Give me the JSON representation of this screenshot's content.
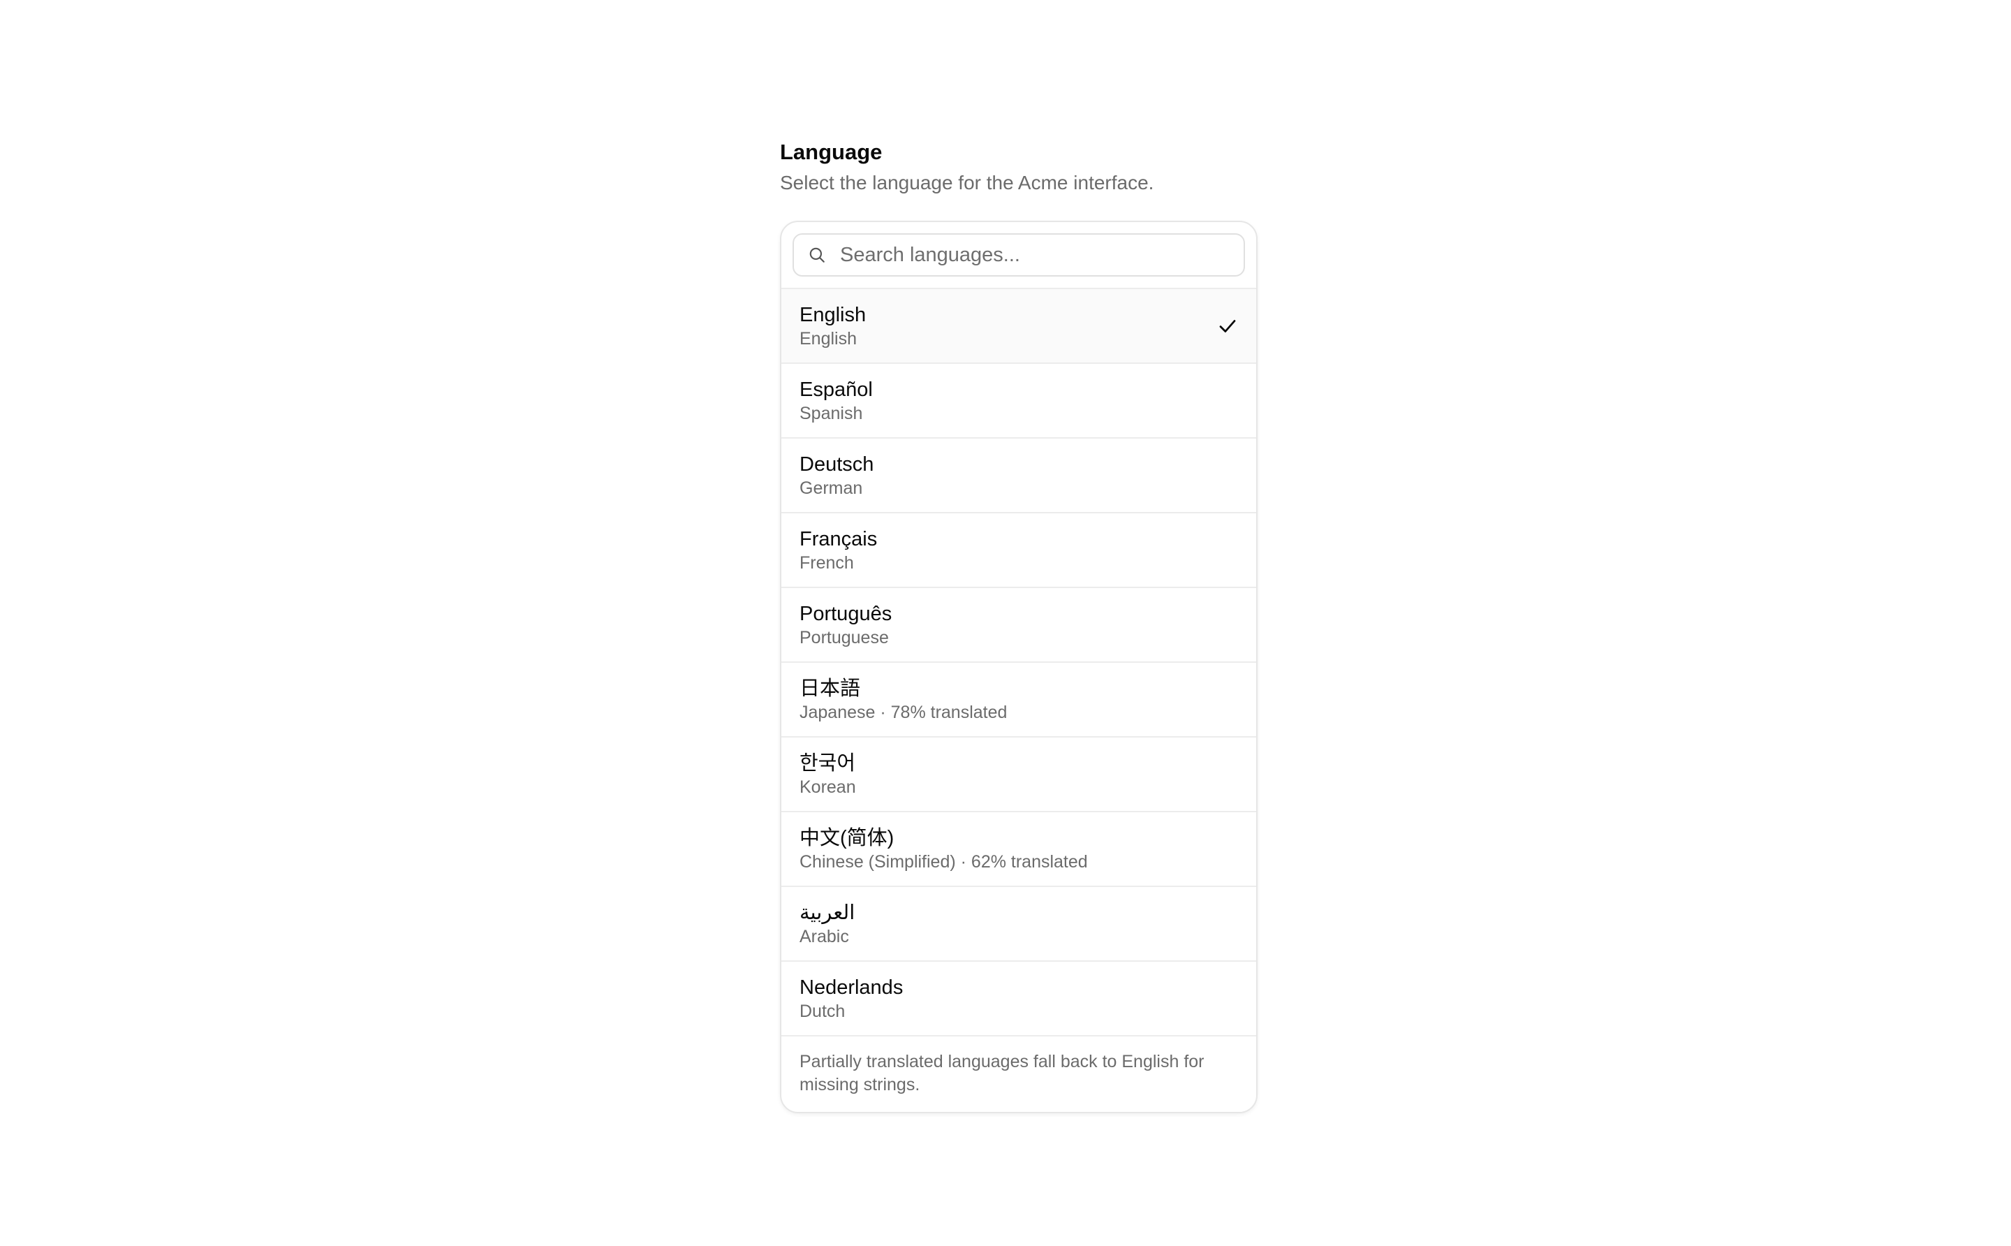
{
  "header": {
    "title": "Language",
    "subtitle": "Select the language for the Acme interface."
  },
  "search": {
    "placeholder": "Search languages...",
    "value": "",
    "icon": "search-icon"
  },
  "languages": [
    {
      "native": "English",
      "english": "English",
      "selected": true
    },
    {
      "native": "Español",
      "english": "Spanish",
      "selected": false
    },
    {
      "native": "Deutsch",
      "english": "German",
      "selected": false
    },
    {
      "native": "Français",
      "english": "French",
      "selected": false
    },
    {
      "native": "Português",
      "english": "Portuguese",
      "selected": false
    },
    {
      "native": "日本語",
      "english": "Japanese · 78% translated",
      "selected": false
    },
    {
      "native": "한국어",
      "english": "Korean",
      "selected": false
    },
    {
      "native": "中文(简体)",
      "english": "Chinese (Simplified) · 62% translated",
      "selected": false
    },
    {
      "native": "العربية",
      "english": "Arabic",
      "selected": false
    },
    {
      "native": "Nederlands",
      "english": "Dutch",
      "selected": false
    }
  ],
  "footer": {
    "note": "Partially translated languages fall back to English for missing strings."
  },
  "colors": {
    "text": "#0a0a0a",
    "muted": "#6b6b6b",
    "border": "#ececec",
    "selected_bg": "#fafafa"
  }
}
